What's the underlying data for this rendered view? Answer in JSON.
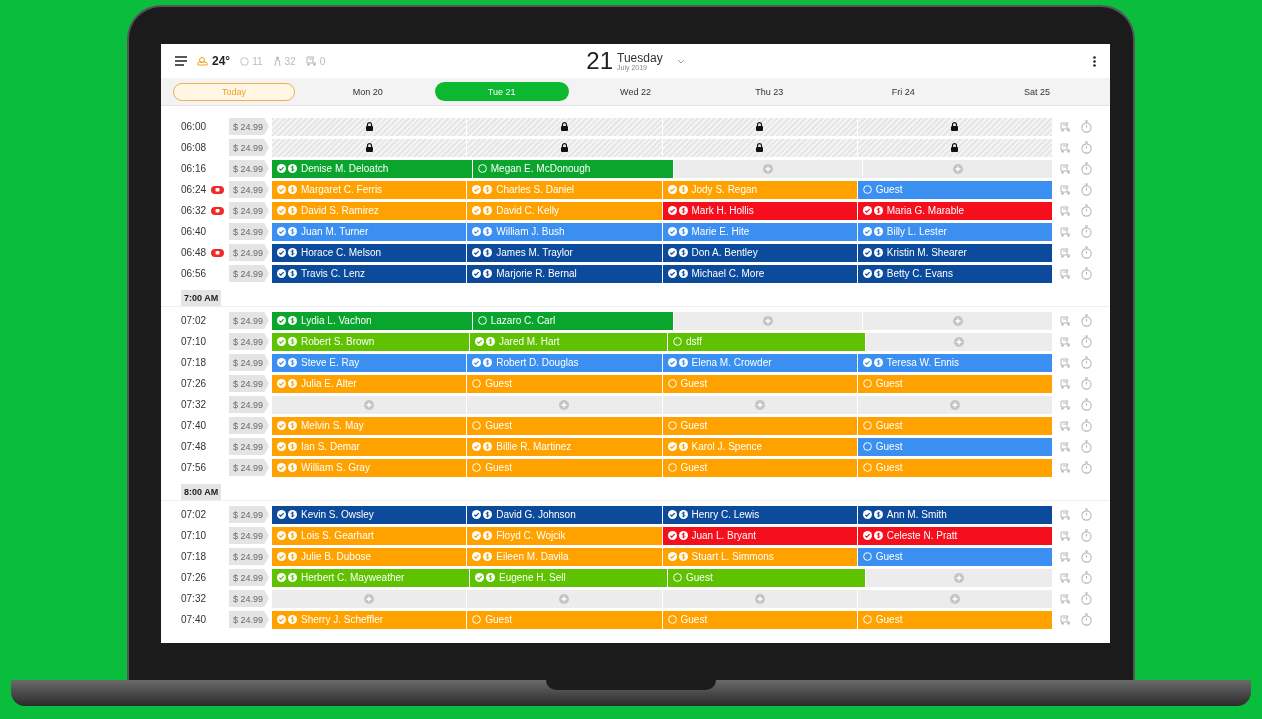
{
  "top_bar": {
    "temperature": "24°",
    "stat_1": "11",
    "stat_2": "32",
    "stat_3": "0",
    "day_number": "21",
    "weekday": "Tuesday",
    "month_year": "July 2019"
  },
  "today_button": "Today",
  "tabs": [
    {
      "label": "Mon 20",
      "selected": false
    },
    {
      "label": "Tue 21",
      "selected": true
    },
    {
      "label": "Wed 22",
      "selected": false
    },
    {
      "label": "Thu 23",
      "selected": false
    },
    {
      "label": "Fri 24",
      "selected": false
    },
    {
      "label": "Sat 25",
      "selected": false
    }
  ],
  "sections": [
    {
      "rows": [
        {
          "time": "06:00",
          "alert": false,
          "price": "$ 24.99",
          "slots": [
            {
              "kind": "locked"
            },
            {
              "kind": "locked"
            },
            {
              "kind": "locked"
            },
            {
              "kind": "locked"
            }
          ]
        },
        {
          "time": "06:08",
          "alert": false,
          "price": "$ 24.99",
          "slots": [
            {
              "kind": "locked"
            },
            {
              "kind": "locked"
            },
            {
              "kind": "locked"
            },
            {
              "kind": "locked"
            }
          ]
        },
        {
          "time": "06:16",
          "alert": false,
          "price": "$ 24.99",
          "slots": [
            {
              "kind": "confirmed",
              "name": "Denise M. Deloatch",
              "color": "#0aa52c"
            },
            {
              "kind": "pending",
              "name": "Megan E. McDonough",
              "color": "#0aa52c"
            },
            {
              "kind": "open"
            },
            {
              "kind": "open"
            }
          ]
        },
        {
          "time": "06:24",
          "alert": true,
          "price": "$ 24.99",
          "slots": [
            {
              "kind": "confirmed",
              "name": "Margaret C. Ferris",
              "color": "#ffa200"
            },
            {
              "kind": "confirmed",
              "name": "Charles S. Daniel",
              "color": "#ffa200"
            },
            {
              "kind": "confirmed",
              "name": "Jody S. Regan",
              "color": "#ffa200"
            },
            {
              "kind": "pending",
              "name": "Guest",
              "color": "#3a8ff0"
            }
          ]
        },
        {
          "time": "06:32",
          "alert": true,
          "price": "$ 24.99",
          "slots": [
            {
              "kind": "confirmed",
              "name": "David S. Ramirez",
              "color": "#ffa200"
            },
            {
              "kind": "confirmed",
              "name": "David C. Kelly",
              "color": "#ffa200"
            },
            {
              "kind": "confirmed",
              "name": "Mark H. Hollis",
              "color": "#f50f1c"
            },
            {
              "kind": "confirmed",
              "name": "Maria G. Marable",
              "color": "#f50f1c"
            }
          ]
        },
        {
          "time": "06:40",
          "alert": false,
          "price": "$ 24.99",
          "slots": [
            {
              "kind": "confirmed",
              "name": "Juan M. Turner",
              "color": "#3a8ff0"
            },
            {
              "kind": "confirmed",
              "name": "William J. Bush",
              "color": "#3a8ff0"
            },
            {
              "kind": "confirmed",
              "name": "Marie E. Hite",
              "color": "#3a8ff0"
            },
            {
              "kind": "confirmed",
              "name": "Billy L. Lester",
              "color": "#3a8ff0"
            }
          ]
        },
        {
          "time": "06:48",
          "alert": true,
          "price": "$ 24.99",
          "slots": [
            {
              "kind": "confirmed",
              "name": "Horace C. Melson",
              "color": "#0c4a9c"
            },
            {
              "kind": "confirmed",
              "name": "James M. Traylor",
              "color": "#0c4a9c"
            },
            {
              "kind": "confirmed",
              "name": "Don A. Bentley",
              "color": "#0c4a9c"
            },
            {
              "kind": "confirmed",
              "name": "Kristin M. Shearer",
              "color": "#0c4a9c"
            }
          ]
        },
        {
          "time": "06:56",
          "alert": false,
          "price": "$ 24.99",
          "slots": [
            {
              "kind": "confirmed",
              "name": "Travis C. Lenz",
              "color": "#0c4a9c"
            },
            {
              "kind": "confirmed",
              "name": "Marjorie R. Bernal",
              "color": "#0c4a9c"
            },
            {
              "kind": "confirmed",
              "name": "Michael C. More",
              "color": "#0c4a9c"
            },
            {
              "kind": "confirmed",
              "name": "Betty C. Evans",
              "color": "#0c4a9c"
            }
          ]
        }
      ]
    },
    {
      "header": "7:00 AM",
      "rows": [
        {
          "time": "07:02",
          "alert": false,
          "price": "$ 24.99",
          "slots": [
            {
              "kind": "confirmed",
              "name": "Lydia L. Vachon",
              "color": "#0aa52c"
            },
            {
              "kind": "pending",
              "name": "Lazaro C. Carl",
              "color": "#0aa52c"
            },
            {
              "kind": "open"
            },
            {
              "kind": "open"
            }
          ]
        },
        {
          "time": "07:10",
          "alert": false,
          "price": "$ 24.99",
          "slots": [
            {
              "kind": "confirmed",
              "name": "Robert S. Brown",
              "color": "#5fc200"
            },
            {
              "kind": "confirmed",
              "name": "Jared M. Hart",
              "color": "#5fc200"
            },
            {
              "kind": "pending",
              "name": "dsff",
              "color": "#5fc200"
            },
            {
              "kind": "open"
            }
          ]
        },
        {
          "time": "07:18",
          "alert": false,
          "price": "$ 24.99",
          "slots": [
            {
              "kind": "confirmed",
              "name": "Steve E. Ray",
              "color": "#3a8ff0"
            },
            {
              "kind": "confirmed",
              "name": "Robert D. Douglas",
              "color": "#3a8ff0"
            },
            {
              "kind": "confirmed",
              "name": "Elena M. Crowder",
              "color": "#3a8ff0"
            },
            {
              "kind": "confirmed",
              "name": "Teresa W. Ennis",
              "color": "#3a8ff0"
            }
          ]
        },
        {
          "time": "07:26",
          "alert": false,
          "price": "$ 24.99",
          "slots": [
            {
              "kind": "confirmed",
              "name": "Julia E. Alter",
              "color": "#ffa200"
            },
            {
              "kind": "pending",
              "name": "Guest",
              "color": "#ffa200"
            },
            {
              "kind": "pending",
              "name": "Guest",
              "color": "#ffa200"
            },
            {
              "kind": "pending",
              "name": "Guest",
              "color": "#ffa200"
            }
          ]
        },
        {
          "time": "07:32",
          "alert": false,
          "price": "$ 24.99",
          "slots": [
            {
              "kind": "open"
            },
            {
              "kind": "open"
            },
            {
              "kind": "open"
            },
            {
              "kind": "open"
            }
          ]
        },
        {
          "time": "07:40",
          "alert": false,
          "price": "$ 24.99",
          "slots": [
            {
              "kind": "confirmed",
              "name": "Melvin S. May",
              "color": "#ffa200"
            },
            {
              "kind": "pending",
              "name": "Guest",
              "color": "#ffa200"
            },
            {
              "kind": "pending",
              "name": "Guest",
              "color": "#ffa200"
            },
            {
              "kind": "pending",
              "name": "Guest",
              "color": "#ffa200"
            }
          ]
        },
        {
          "time": "07:48",
          "alert": false,
          "price": "$ 24.99",
          "slots": [
            {
              "kind": "confirmed",
              "name": "Ian S. Demar",
              "color": "#ffa200"
            },
            {
              "kind": "confirmed",
              "name": "Billie R. Martinez",
              "color": "#ffa200"
            },
            {
              "kind": "confirmed",
              "name": "Karol J. Spence",
              "color": "#ffa200"
            },
            {
              "kind": "pending",
              "name": "Guest",
              "color": "#3a8ff0"
            }
          ]
        },
        {
          "time": "07:56",
          "alert": false,
          "price": "$ 24.99",
          "slots": [
            {
              "kind": "confirmed",
              "name": "William S. Gray",
              "color": "#ffa200"
            },
            {
              "kind": "pending",
              "name": "Guest",
              "color": "#ffa200"
            },
            {
              "kind": "pending",
              "name": "Guest",
              "color": "#ffa200"
            },
            {
              "kind": "pending",
              "name": "Guest",
              "color": "#ffa200"
            }
          ]
        }
      ]
    },
    {
      "header": "8:00 AM",
      "rows": [
        {
          "time": "07:02",
          "alert": false,
          "price": "$ 24.99",
          "slots": [
            {
              "kind": "confirmed",
              "name": "Kevin S. Owsley",
              "color": "#0c4a9c"
            },
            {
              "kind": "confirmed",
              "name": "David G. Johnson",
              "color": "#0c4a9c"
            },
            {
              "kind": "confirmed",
              "name": "Henry C. Lewis",
              "color": "#0c4a9c"
            },
            {
              "kind": "confirmed",
              "name": "Ann M. Smith",
              "color": "#0c4a9c"
            }
          ]
        },
        {
          "time": "07:10",
          "alert": false,
          "price": "$ 24.99",
          "slots": [
            {
              "kind": "confirmed",
              "name": "Lois S. Gearhart",
              "color": "#ffa200"
            },
            {
              "kind": "confirmed",
              "name": "Floyd C. Wojcik",
              "color": "#ffa200"
            },
            {
              "kind": "confirmed",
              "name": "Juan L. Bryant",
              "color": "#f50f1c"
            },
            {
              "kind": "confirmed",
              "name": "Celeste N. Pratt",
              "color": "#f50f1c"
            }
          ]
        },
        {
          "time": "07:18",
          "alert": false,
          "price": "$ 24.99",
          "slots": [
            {
              "kind": "confirmed",
              "name": "Julie B. Dubose",
              "color": "#ffa200"
            },
            {
              "kind": "confirmed",
              "name": "Eileen M. Davila",
              "color": "#ffa200"
            },
            {
              "kind": "confirmed",
              "name": "Stuart L. Simmons",
              "color": "#ffa200"
            },
            {
              "kind": "pending",
              "name": "Guest",
              "color": "#3a8ff0"
            }
          ]
        },
        {
          "time": "07:26",
          "alert": false,
          "price": "$ 24.99",
          "slots": [
            {
              "kind": "confirmed",
              "name": "Herbert C. Mayweather",
              "color": "#5fc200"
            },
            {
              "kind": "confirmed",
              "name": "Eugene H. Sell",
              "color": "#5fc200"
            },
            {
              "kind": "pending",
              "name": "Guest",
              "color": "#5fc200"
            },
            {
              "kind": "open"
            }
          ]
        },
        {
          "time": "07:32",
          "alert": false,
          "price": "$ 24.99",
          "slots": [
            {
              "kind": "open"
            },
            {
              "kind": "open"
            },
            {
              "kind": "open"
            },
            {
              "kind": "open"
            }
          ]
        },
        {
          "time": "07:40",
          "alert": false,
          "price": "$ 24.99",
          "slots": [
            {
              "kind": "confirmed",
              "name": "Sherry J. Scheffler",
              "color": "#ffa200"
            },
            {
              "kind": "pending",
              "name": "Guest",
              "color": "#ffa200"
            },
            {
              "kind": "pending",
              "name": "Guest",
              "color": "#ffa200"
            },
            {
              "kind": "pending",
              "name": "Guest",
              "color": "#ffa200"
            }
          ]
        }
      ]
    }
  ]
}
